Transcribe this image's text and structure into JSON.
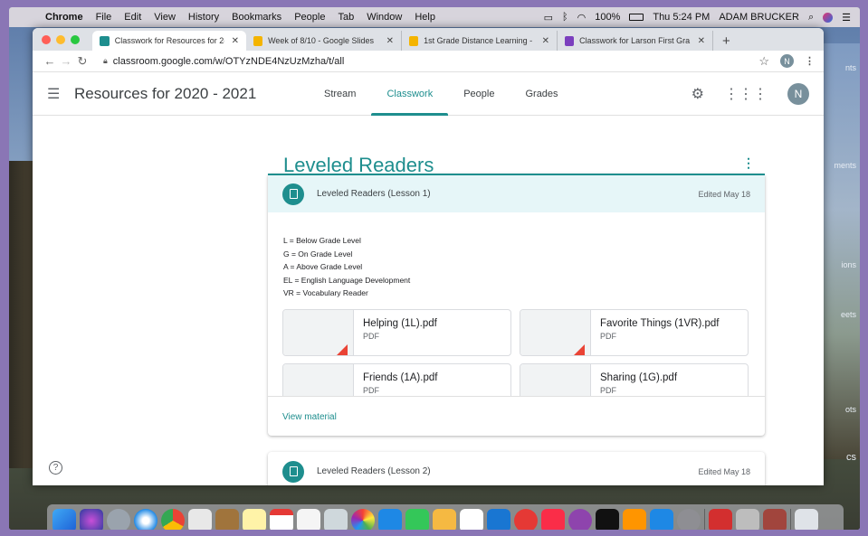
{
  "menubar": {
    "app": "Chrome",
    "items": [
      "File",
      "Edit",
      "View",
      "History",
      "Bookmarks",
      "People",
      "Tab",
      "Window",
      "Help"
    ],
    "battery": "100%",
    "clock": "Thu 5:24 PM",
    "user": "ADAM BRUCKER"
  },
  "browser": {
    "tabs": [
      {
        "title": "Classwork for Resources for 2(",
        "color": "#1e8e8e",
        "active": true
      },
      {
        "title": "Week of 8/10 - Google Slides",
        "color": "#f4b400",
        "active": false
      },
      {
        "title": "1st Grade Distance Learning - ",
        "color": "#f4b400",
        "active": false
      },
      {
        "title": "Classwork for Larson First Gra",
        "color": "#7b3fbe",
        "active": false
      }
    ],
    "url": "classroom.google.com/w/OTYzNDE4NzUzMzha/t/all",
    "profile_initial": "N"
  },
  "classroom": {
    "class_title": "Resources for 2020 - 2021",
    "tabs": [
      "Stream",
      "Classwork",
      "People",
      "Grades"
    ],
    "active_tab": "Classwork",
    "avatar_initial": "N"
  },
  "section": {
    "title": "Leveled Readers",
    "more_label": "⋮"
  },
  "material1": {
    "title": "Leveled Readers (Lesson 1)",
    "edited": "Edited May 18",
    "description": [
      "L = Below Grade Level",
      "G = On Grade Level",
      "A = Above Grade Level",
      "EL = English Language Development",
      "VR = Vocabulary Reader"
    ],
    "attachments": [
      {
        "name": "Helping (1L).pdf",
        "type": "PDF"
      },
      {
        "name": "Favorite Things (1VR).pdf",
        "type": "PDF"
      },
      {
        "name": "Friends (1A).pdf",
        "type": "PDF"
      },
      {
        "name": "Sharing (1G).pdf",
        "type": "PDF"
      }
    ],
    "view_label": "View material"
  },
  "material2": {
    "title": "Leveled Readers (Lesson 2)",
    "edited": "Edited May 18"
  },
  "desktop": {
    "side_labels": [
      "nts",
      "ments",
      "ions",
      "eets",
      "ots",
      "cs"
    ]
  },
  "help_label": "?"
}
